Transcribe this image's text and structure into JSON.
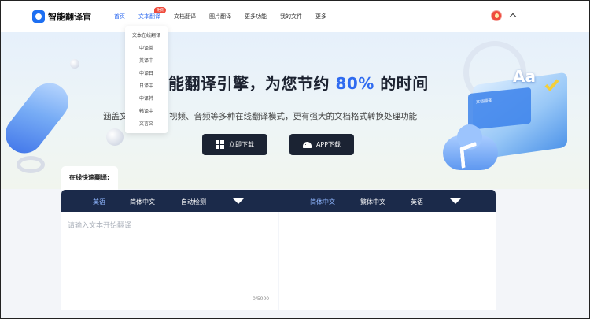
{
  "app": {
    "name": "智能翻译官"
  },
  "nav": {
    "items": [
      "首页",
      "文本翻译",
      "文档翻译",
      "图片翻译",
      "更多功能",
      "我的文件",
      "更多"
    ],
    "badge": "免费"
  },
  "dropdown": {
    "items": [
      "文本在线翻译",
      "中译英",
      "英译中",
      "中译日",
      "日译中",
      "中译韩",
      "韩译中",
      "文言文"
    ]
  },
  "hero": {
    "title_prefix": "能翻译引擎，为您节约 ",
    "title_pct": "80%",
    "title_suffix": " 的时间",
    "subtitle": "涵盖文本、图片、视频、音频等多种在线翻译模式，更有强大的文档格式转换处理功能",
    "btn_download": "立即下载",
    "btn_app": "APP下载",
    "card_text": "文档翻译"
  },
  "deco": {
    "aa": "Aa"
  },
  "translator": {
    "quick_label": "在线快速翻译:",
    "left_langs": [
      "英语",
      "简体中文",
      "自动检测"
    ],
    "right_langs": [
      "简体中文",
      "繁体中文",
      "英语"
    ],
    "input_placeholder": "请输入文本开始翻译",
    "char_count": "0/5000"
  },
  "colors": {
    "accent": "#2f6bf0",
    "lang_bar": "#1b2a4a",
    "button_dark": "#1b2333",
    "badge": "#ef4b3c"
  }
}
